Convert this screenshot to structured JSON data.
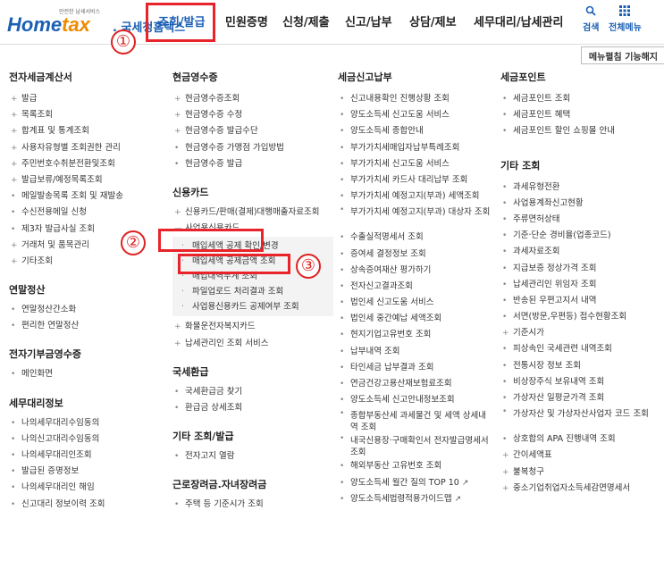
{
  "logo": {
    "small_text": "안전한 납세서비스",
    "brand_a": "Home",
    "brand_b": "tax",
    "sub": ". 국세청홈택스"
  },
  "gnb": [
    "조회/발급",
    "민원증명",
    "신청/제출",
    "신고/납부",
    "상담/제보",
    "세무대리/납세관리"
  ],
  "util": [
    {
      "label": "검색",
      "icon": "search-icon"
    },
    {
      "label": "전체메뉴",
      "icon": "grid-icon"
    }
  ],
  "menu_toggle": "메뉴펼침 기능해지",
  "markers": {
    "circle_1": "①",
    "circle_2": "②",
    "circle_3": "③"
  },
  "col1": {
    "sec1": {
      "title": "전자세금계산서",
      "items": [
        "발급",
        "목록조회",
        "합계표 및 통계조회",
        "사용자유형별 조회권한 관리",
        "주민번호수취분전환및조회",
        "발급보류/예정목록조회",
        "메일발송목록 조회 및 재발송",
        "수신전용메일 신청",
        "제3자 발급사실 조회",
        "거래처 및 품목관리",
        "기타조회"
      ]
    },
    "sec2": {
      "title": "연말정산",
      "items": [
        "연말정산간소화",
        "편리한 연말정산"
      ]
    },
    "sec3": {
      "title": "전자기부금영수증",
      "items": [
        "메인화면"
      ]
    },
    "sec4": {
      "title": "세무대리정보",
      "items": [
        "나의세무대리수임동의",
        "나의신고대리수임동의",
        "나의세무대리인조회",
        "발급된 증명정보",
        "나의세무대리인 해임",
        "신고대리 정보이력 조회"
      ]
    }
  },
  "col2": {
    "sec1": {
      "title": "현금영수증",
      "items": [
        "현금영수증조회",
        "현금영수증 수정",
        "현금영수증 발급수단",
        "현금영수증 가맹점 가입방법",
        "현금영수증 발급"
      ]
    },
    "sec2": {
      "title": "신용카드",
      "item_top": "신용카드/판매(결제)대행매출자료조회",
      "item_biz": "사업용신용카드",
      "subs": [
        "매입세액 공제 확인/변경",
        "매입세액 공제금액 조회",
        "매입내역누계 조회",
        "파일업로드 처리결과 조회",
        "사업용신용카드 공제여부 조회"
      ],
      "items_after": [
        "화물운전자복지카드",
        "납세관리인 조회 서비스"
      ]
    },
    "sec3": {
      "title": "국세환급",
      "items": [
        "국세환급금 찾기",
        "환급금 상세조회"
      ]
    },
    "sec4": {
      "title": "기타 조회/발급",
      "items": [
        "전자고지 열람"
      ]
    },
    "sec5": {
      "title": "근로장려금.자녀장려금",
      "items": [
        "주택 등 기준시가 조회"
      ]
    }
  },
  "col3": {
    "sec1": {
      "title": "세금신고납부",
      "items": [
        "신고내용확인 진행상황 조회",
        "양도소득세 신고도움 서비스",
        "양도소득세 종합안내",
        "부가가치세매입자납부특례조회",
        "부가가치세 신고도움 서비스",
        "부가가치세 카드사 대리납부 조회",
        "부가가치세 예정고지(부과) 세액조회",
        "부가가치세 예정고지(부과) 대상자 조회",
        "수출실적명세서 조회",
        "증여세 결정정보 조회",
        "상속증여재산 평가하기",
        "전자신고결과조회",
        "법인세 신고도움 서비스",
        "법인세 중간예납 세액조회",
        "현지기업고유번호 조회",
        "납부내역 조회",
        "타인세금 납부결과 조회",
        "연금건강고용산재보험료조회",
        "양도소득세 신고안내정보조회",
        "종합부동산세 과세물건 및 세액 상세내역 조회",
        "내국신용장·구매확인서 전자발급명세서 조회",
        "해외부동산 고유번호 조회",
        "양도소득세 월간 질의 TOP 10",
        "양도소득세법령적용가이드맵"
      ]
    }
  },
  "col4": {
    "sec1": {
      "title": "세금포인트",
      "items": [
        "세금포인트 조회",
        "세금포인트 혜택",
        "세금포인트 할인 쇼핑몰 안내"
      ]
    },
    "sec2": {
      "title": "기타 조회",
      "items": [
        "과세유형전환",
        "사업용계좌신고현황",
        "주류면허상태",
        "기준·단순 경비율(업종코드)",
        "과세자료조회",
        "지급보증 정상가격 조회",
        "납세관리인 위임자 조회",
        "반송된 우편고지서 내역",
        "서면(방문,우편등) 접수현황조회",
        "기준시가",
        "피상속인 국세관련 내역조회",
        "전통시장 정보 조회",
        "비상장주식 보유내역 조회",
        "가상자산 일평균가격 조회",
        "가상자산 및 가상자산사업자 코드 조회",
        "상호합의 APA 진행내역 조회",
        "간이세액표",
        "불복청구",
        "중소기업취업자소득세감면명세서"
      ]
    }
  }
}
